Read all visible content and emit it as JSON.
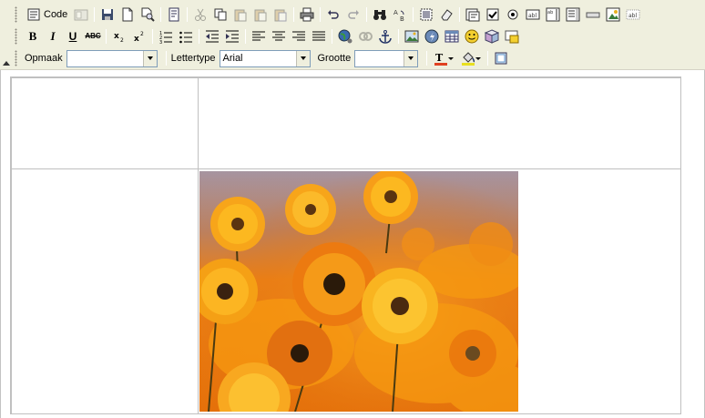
{
  "toolbar": {
    "row1": {
      "code_label": "Code"
    },
    "row3": {
      "format": {
        "label": "Opmaak",
        "value": ""
      },
      "font": {
        "label": "Lettertype",
        "value": "Arial"
      },
      "size": {
        "label": "Grootte",
        "value": ""
      }
    },
    "icons": {
      "code": "code-view-icon",
      "bold": "B",
      "italic": "I",
      "underline": "U",
      "strike": "ABC",
      "subscript": "x2",
      "superscript": "x2"
    }
  },
  "colors": {
    "toolbar_bg": "#efefde",
    "border": "#c0c0c0",
    "combo_border": "#7f9db9"
  },
  "editor": {
    "table": {
      "rows": 2,
      "cols": 2,
      "image": {
        "subject": "orange daisy flowers photo"
      }
    }
  }
}
